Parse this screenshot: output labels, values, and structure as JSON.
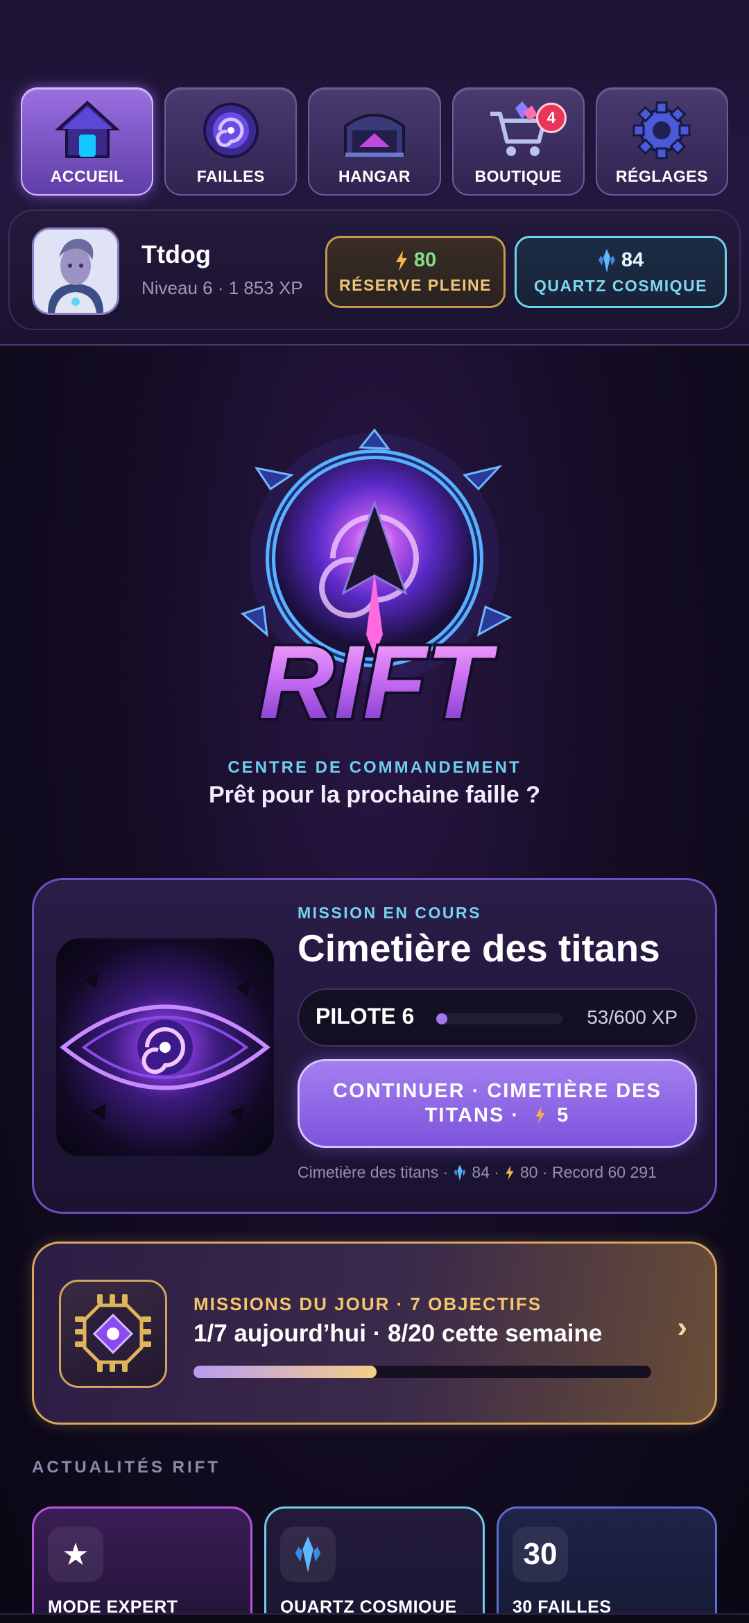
{
  "nav": {
    "items": [
      {
        "label": "ACCUEIL",
        "icon": "home-icon",
        "active": true
      },
      {
        "label": "FAILLES",
        "icon": "rift-portal-icon"
      },
      {
        "label": "HANGAR",
        "icon": "hangar-icon"
      },
      {
        "label": "BOUTIQUE",
        "icon": "shop-cart-icon",
        "badge": "4"
      },
      {
        "label": "RÉGLAGES",
        "icon": "gear-icon"
      }
    ]
  },
  "profile": {
    "name": "Ttdog",
    "level": "Niveau 6 · 1 853 XP",
    "energy": {
      "value": "80",
      "label": "RÉSERVE PLEINE"
    },
    "quartz": {
      "value": "84",
      "label": "QUARTZ COSMIQUE"
    }
  },
  "hero": {
    "logo_text": "RIFT",
    "subtitle": "CENTRE DE COMMANDEMENT",
    "tagline": "Prêt pour la prochaine faille ?"
  },
  "mission": {
    "label": "MISSION EN COURS",
    "title": "Cimetière des titans",
    "pilot_label": "PILOTE 6",
    "pilot_xp": "53/600 XP",
    "pilot_progress": 0.088,
    "cta": "CONTINUER · CIMETIÈRE DES TITANS ·",
    "cta_cost": "5",
    "meta_name": "Cimetière des titans ·",
    "meta_quartz": "84 ·",
    "meta_energy": "80 · Record 60 291"
  },
  "daily": {
    "label": "MISSIONS DU JOUR · 7 OBJECTIFS",
    "title": "1/7 aujourd’hui · 8/20 cette semaine",
    "progress": 0.4,
    "chevron": "›"
  },
  "news": {
    "heading": "ACTUALITÉS RIFT",
    "cards": [
      {
        "icon_text": "★",
        "title": "MODE EXPERT"
      },
      {
        "icon_text": "",
        "title": "QUARTZ COSMIQUE"
      },
      {
        "icon_text": "30",
        "title": "30 FAILLES"
      }
    ]
  },
  "colors": {
    "accent": "#9b6fe0",
    "quartz": "#6fd3ee",
    "energy": "#c49a4e",
    "gold": "#f3c66c"
  }
}
